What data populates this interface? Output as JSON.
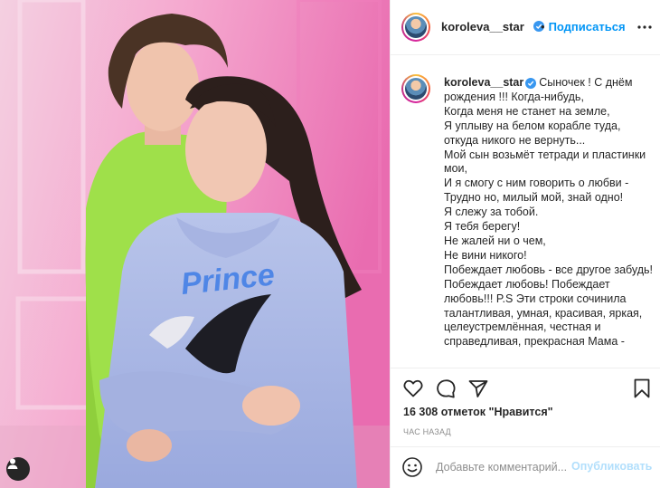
{
  "post": {
    "username": "koroleva__star",
    "follow_label": "Подписаться",
    "caption": "Сыночек ! С днём рождения !!! Когда-нибудь,\nКогда меня не станет на земле,\nЯ уплыву на белом корабле туда,\nоткуда никого не вернуть...\nМой сын возьмёт тетради и пластинки мои,\nИ я смогу с ним говорить о любви -\nТрудно но, милый мой, знай одно!\nЯ слежу за тобой.\nЯ тебя берегу!\nНе жалей ни о чем,\nНе вини никого!\nПобеждает любовь - все другое забудь!\nПобеждает любовь! Побеждает любовь!!! P.S Эти строки сочинила талантливая, умная, красивая, яркая, целеустремлённая, честная и справедливая, прекрасная Мама -",
    "likes": "16 308 отметок \"Нравится\"",
    "likes_count": "16 308",
    "likes_suffix": "отметок \"Нравится\"",
    "time_ago": "ЧАС НАЗАД",
    "comment_placeholder": "Добавьте комментарий...",
    "publish_label": "Опубликовать",
    "photo_text": "Prince"
  },
  "icons": {
    "like": "heart-icon",
    "comment": "comment-icon",
    "share": "paper-plane-icon",
    "save": "bookmark-icon",
    "more": "more-options-icon",
    "emoji": "smiley-icon",
    "tags": "user-tag-icon",
    "verified": "verified-badge-icon"
  },
  "colors": {
    "accent": "#0095f6",
    "verified": "#3897f0",
    "publish_disabled": "#b2dffc",
    "muted": "#8e8e8e"
  }
}
